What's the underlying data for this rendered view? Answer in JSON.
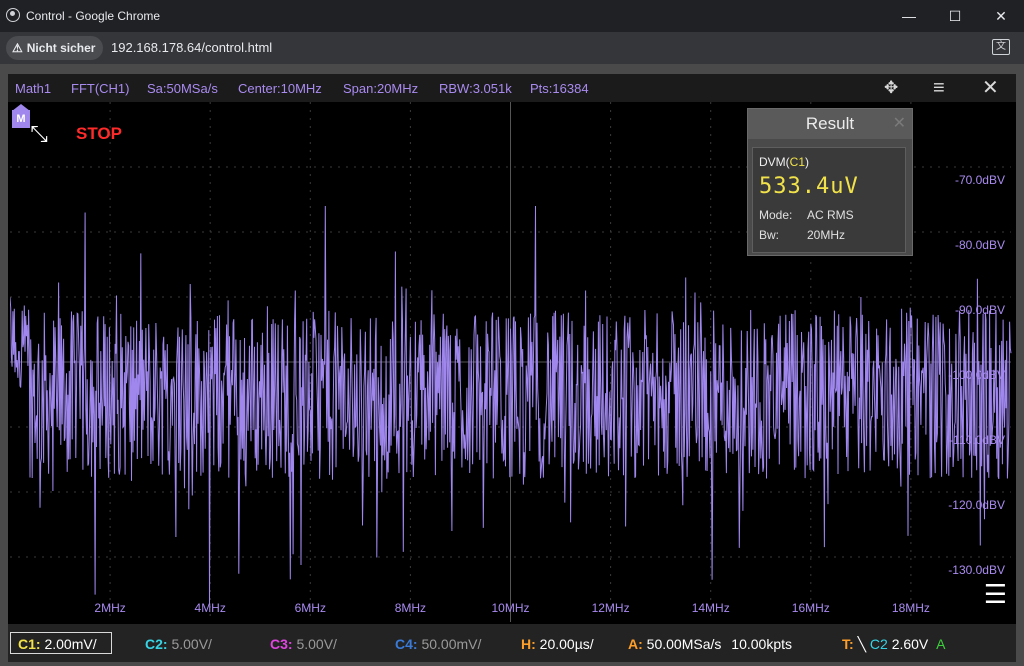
{
  "browser": {
    "title": "Control - Google Chrome",
    "security_label": "Nicht sicher",
    "url": "192.168.178.64/control.html",
    "minimize_glyph": "—",
    "maximize_glyph": "☐",
    "close_glyph": "✕"
  },
  "topbar": {
    "math": "Math1",
    "fft": "FFT(CH1)",
    "sa": "Sa:50MSa/s",
    "center": "Center:10MHz",
    "span": "Span:20MHz",
    "rbw": "RBW:3.051k",
    "pts": "Pts:16384"
  },
  "status": {
    "marker": "M",
    "run_state": "STOP"
  },
  "result": {
    "title": "Result",
    "dvm_prefix": "DVM(",
    "dvm_channel": "C1",
    "dvm_suffix": ")",
    "value": "533.4uV",
    "mode_label": "Mode:",
    "mode_value": "AC RMS",
    "bw_label": "Bw:",
    "bw_value": "20MHz"
  },
  "chart_data": {
    "type": "line",
    "xlabel": "",
    "ylabel": "",
    "x_tick_labels": [
      "2MHz",
      "4MHz",
      "6MHz",
      "8MHz",
      "10MHz",
      "12MHz",
      "14MHz",
      "16MHz",
      "18MHz"
    ],
    "y_tick_labels": [
      "-70.0dBV",
      "-80.0dBV",
      "-90.0dBV",
      "-100.0dBV",
      "-110.0dBV",
      "-120.0dBV",
      "-130.0dBV"
    ],
    "xlim_mhz": [
      0,
      20
    ],
    "ylim_dbv": [
      -138,
      -58
    ],
    "series": [
      {
        "color": "#9f87ee",
        "noise_floor_dbv": -103,
        "peaks": [
          {
            "x": 1.5,
            "y": -75
          },
          {
            "x": 3.6,
            "y": -86
          },
          {
            "x": 5.7,
            "y": -87
          },
          {
            "x": 6.3,
            "y": -74
          },
          {
            "x": 7.7,
            "y": -81
          },
          {
            "x": 10.5,
            "y": -74
          },
          {
            "x": 11.5,
            "y": -87
          },
          {
            "x": 13.5,
            "y": -85
          },
          {
            "x": 14.8,
            "y": -90
          },
          {
            "x": 17.0,
            "y": -88
          },
          {
            "x": 19.7,
            "y": -90
          }
        ]
      }
    ],
    "grid": true
  },
  "bottombar": {
    "c1_label": "C1:",
    "c1_value": "2.00mV/",
    "c2_label": "C2:",
    "c2_value": "5.00V/",
    "c3_label": "C3:",
    "c3_value": "5.00V/",
    "c4_label": "C4:",
    "c4_value": "50.00mV/",
    "h_label": "H:",
    "h_value": "20.00µs/",
    "a_label": "A:",
    "a_value": "50.00MSa/s",
    "a_pts": "10.00kpts",
    "t_label": "T:",
    "t_source": "C2",
    "t_level": "2.60V",
    "t_mode": "A"
  },
  "colors": {
    "trace": "#9f87ee",
    "c1": "#f2e24a",
    "c2": "#37d4e6",
    "c3": "#e045e0",
    "c4": "#3a7bd8",
    "orange": "#ff9f2a",
    "stop": "#ff2a2a"
  }
}
